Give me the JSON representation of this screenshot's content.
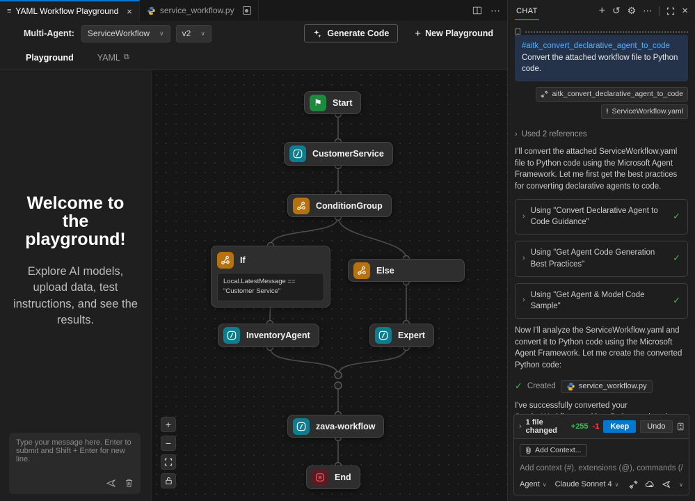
{
  "editor": {
    "tabs": [
      {
        "title": "YAML Workflow Playground"
      },
      {
        "title": "service_workflow.py"
      }
    ],
    "toolbar": {
      "label": "Multi-Agent:",
      "workflow_select": "ServiceWorkflow",
      "version_select": "v2",
      "generate_code": "Generate Code",
      "new_playground": "New Playground"
    },
    "subnav": {
      "playground": "Playground",
      "yaml": "YAML"
    }
  },
  "welcome": {
    "title": "Welcome to the playground!",
    "subtitle": "Explore AI models, upload data, test instructions, and see the results.",
    "input_placeholder": "Type your message here. Enter to submit and Shift + Enter for new line."
  },
  "canvas": {
    "nodes": [
      {
        "label": "Start"
      },
      {
        "label": "CustomerService"
      },
      {
        "label": "ConditionGroup"
      },
      {
        "label": "If",
        "condition": "Local.LatestMessage == \"Customer Service\""
      },
      {
        "label": "Else"
      },
      {
        "label": "InventoryAgent"
      },
      {
        "label": "Expert"
      },
      {
        "label": "zava-workflow"
      },
      {
        "label": "End"
      }
    ]
  },
  "chat": {
    "title": "CHAT",
    "user_message": {
      "command": "#aitk_convert_declarative_agent_to_code",
      "text": "Convert the attached workflow file to Python code."
    },
    "attachments": [
      {
        "label": "aitk_convert_declarative_agent_to_code"
      },
      {
        "label": "ServiceWorkflow.yaml",
        "badge": "!"
      }
    ],
    "references": "Used 2 references",
    "paragraphs": [
      "I'll convert the attached ServiceWorkflow.yaml file to Python code using the Microsoft Agent Framework. Let me first get the best practices for converting declarative agents to code.",
      "Now I'll analyze the ServiceWorkflow.yaml and convert it to Python code using the Microsoft Agent Framework. Let me create the converted Python code:",
      "I've successfully converted your ServiceWorkflow.yaml into Python code using the Microsoft Agent Framework. Here's what the conversion includes:"
    ],
    "tool_cards": [
      {
        "label": "Using \"Convert Declarative Agent to Code Guidance\""
      },
      {
        "label": "Using \"Get Agent Code Generation Best Practices\""
      },
      {
        "label": "Using \"Get Agent & Model Code Sample\""
      }
    ],
    "created": {
      "label": "Created",
      "file": "service_workflow.py"
    },
    "dash": "—",
    "files_bar": {
      "summary": "1 file changed",
      "additions": "+255",
      "deletions": "-1",
      "keep": "Keep",
      "undo": "Undo"
    },
    "input": {
      "add_context": "Add Context...",
      "placeholder": "Add context (#), extensions (@), commands (/)",
      "agent": "Agent",
      "model": "Claude Sonnet 4"
    }
  },
  "icons": {
    "hamburger": "≡",
    "close": "×",
    "plus": "+",
    "history": "↺",
    "gear": "⚙",
    "ellipsis": "⋯",
    "chevron_down": "∨",
    "chevron_right": "›",
    "check": "✓",
    "flag": "⚑",
    "external": "⧉",
    "warning": "!",
    "minus": "−",
    "dash": "—"
  },
  "colors": {
    "accent_blue": "#0078d4",
    "link_blue": "#4fb0ff",
    "add_green": "#3fb950",
    "del_red": "#f85149",
    "node_green": "#1d8a3e",
    "node_teal": "#0e7d8f",
    "node_orange": "#b5720f",
    "node_red": "#5a1b22"
  }
}
